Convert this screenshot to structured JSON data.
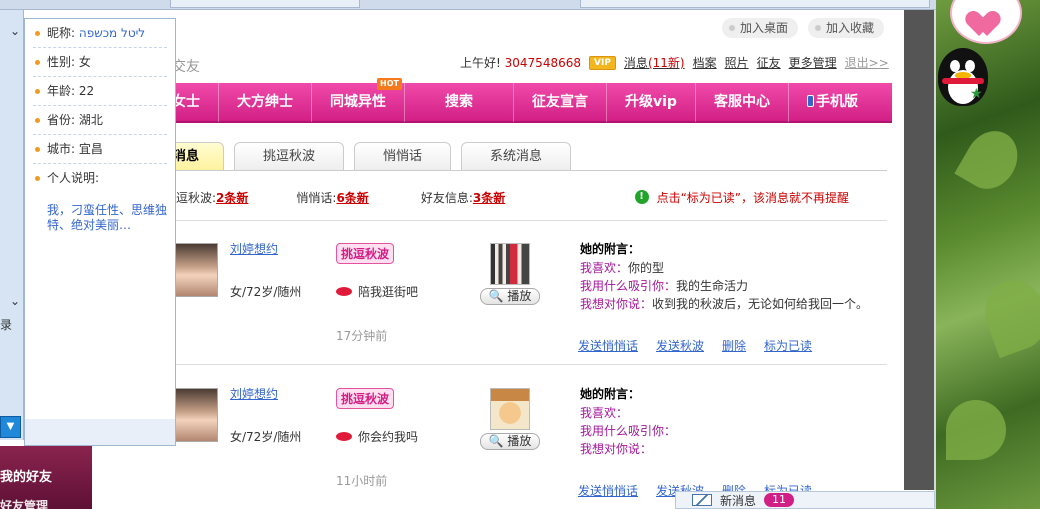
{
  "top_links": {
    "add_desktop": "加入桌面",
    "add_favorite": "加入收藏"
  },
  "site_name": "交友",
  "userbar": {
    "greeting": "上午好!",
    "user_id": "3047548668",
    "vip": "VIP",
    "messages": "消息",
    "messages_new": "(11新)",
    "profile": "档案",
    "photos": "照片",
    "dating": "征友",
    "more": "更多管理",
    "logout": "退出>>"
  },
  "nav": {
    "items": [
      "女士",
      "大方绅士",
      "同城异性",
      "搜索",
      "征友宣言",
      "升级vip",
      "客服中心",
      "手机版"
    ],
    "hot_label": "HOT"
  },
  "tabs": [
    "消息",
    "挑逗秋波",
    "悄悄话",
    "系统消息"
  ],
  "summary": {
    "flirt_label": "逗秋波:",
    "flirt_count": "2条新",
    "whisper_label": "悄悄话:",
    "whisper_count": "6条新",
    "friend_label": "好友信息:",
    "friend_count": "3条新",
    "notice": "点击“标为已读”，该消息就不再提醒"
  },
  "messages": [
    {
      "name": "刘婷想约",
      "info": "女/72岁/随州",
      "type": "挑逗秋波",
      "text": "陪我逛街吧",
      "time": "17分钟前",
      "play": "播放",
      "note_title": "她的附言：",
      "likes_label": "我喜欢：",
      "likes": "你的型",
      "attract_label": "我用什么吸引你：",
      "attract": "我的生命活力",
      "say_label": "我想对你说：",
      "say": "收到我的秋波后，无论如何给我回一个。",
      "actions": [
        "发送悄悄话",
        "发送秋波",
        "删除",
        "标为已读"
      ]
    },
    {
      "name": "刘婷想约",
      "info": "女/72岁/随州",
      "type": "挑逗秋波",
      "text": "你会约我吗",
      "time": "11小时前",
      "play": "播放",
      "note_title": "她的附言：",
      "likes_label": "我喜欢：",
      "likes": "",
      "attract_label": "我用什么吸引你：",
      "attract": "",
      "say_label": "我想对你说：",
      "say": "",
      "actions": [
        "发送悄悄话",
        "发送秋波",
        "删除",
        "标为已读"
      ]
    }
  ],
  "new_message_bar": {
    "label": "新消息",
    "count": "11"
  },
  "profile": {
    "nickname_label": "昵称:",
    "nickname": "ליטל מכשפה",
    "gender_label": "性别:",
    "gender": "女",
    "age_label": "年龄:",
    "age": "22",
    "province_label": "省份:",
    "province": "湖北",
    "city_label": "城市:",
    "city": "宜昌",
    "desc_label": "个人说明:",
    "desc": "我，刁蛮任性、思维独特、绝对美丽…"
  },
  "left_panel": {
    "record": "录",
    "my_friends": "我的好友",
    "friend_manage": "好友管理"
  }
}
